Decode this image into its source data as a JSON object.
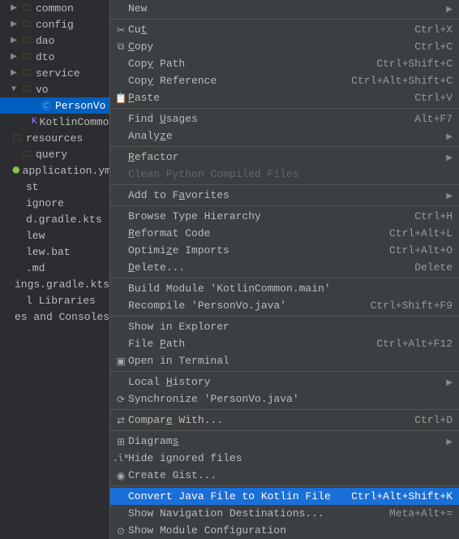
{
  "tree": {
    "items": [
      {
        "indent": 1,
        "arrow": "▶",
        "icon": "folder",
        "label": "common"
      },
      {
        "indent": 1,
        "arrow": "▶",
        "icon": "folder",
        "label": "config"
      },
      {
        "indent": 1,
        "arrow": "▶",
        "icon": "folder",
        "label": "dao"
      },
      {
        "indent": 1,
        "arrow": "▶",
        "icon": "folder",
        "label": "dto"
      },
      {
        "indent": 1,
        "arrow": "▶",
        "icon": "folder",
        "label": "service"
      },
      {
        "indent": 1,
        "arrow": "▼",
        "icon": "folderopen",
        "label": "vo"
      },
      {
        "indent": 3,
        "arrow": "",
        "icon": "kclass",
        "label": "PersonVo",
        "sel": true
      },
      {
        "indent": 3,
        "arrow": "",
        "icon": "kfile",
        "label": "KotlinCommonA"
      },
      {
        "indent": 0,
        "arrow": "",
        "icon": "folder",
        "label": "resources"
      },
      {
        "indent": 1,
        "arrow": "",
        "icon": "folder",
        "label": "query"
      },
      {
        "indent": 1,
        "arrow": "",
        "icon": "yml",
        "label": "application.yml"
      },
      {
        "indent": 0,
        "arrow": "",
        "icon": "",
        "label": "st"
      },
      {
        "indent": 0,
        "arrow": "",
        "icon": "",
        "label": "ignore"
      },
      {
        "indent": 0,
        "arrow": "",
        "icon": "",
        "label": "d.gradle.kts"
      },
      {
        "indent": 0,
        "arrow": "",
        "icon": "",
        "label": "lew"
      },
      {
        "indent": 0,
        "arrow": "",
        "icon": "",
        "label": "lew.bat"
      },
      {
        "indent": 0,
        "arrow": "",
        "icon": "",
        "label": ".md"
      },
      {
        "indent": 0,
        "arrow": "",
        "icon": "",
        "label": "ings.gradle.kts"
      },
      {
        "indent": 0,
        "arrow": "",
        "icon": "",
        "label": "l Libraries"
      },
      {
        "indent": 0,
        "arrow": "",
        "icon": "",
        "label": "es and Consoles"
      }
    ]
  },
  "menu": [
    {
      "icon": "",
      "label": "New",
      "shortcut": "",
      "sub": true
    },
    {
      "sep": true
    },
    {
      "icon": "✂",
      "label_html": "Cu<span class='u'>t</span>",
      "shortcut": "Ctrl+X"
    },
    {
      "icon": "⧉",
      "label_html": "<span class='u'>C</span>opy",
      "shortcut": "Ctrl+C"
    },
    {
      "icon": "",
      "label_html": "Cop<span class='u'>y</span> Path",
      "shortcut": "Ctrl+Shift+C"
    },
    {
      "icon": "",
      "label_html": "Cop<span class='u'>y</span> Reference",
      "shortcut": "Ctrl+Alt+Shift+C"
    },
    {
      "icon": "📋",
      "label_html": "<span class='u'>P</span>aste",
      "shortcut": "Ctrl+V"
    },
    {
      "sep": true
    },
    {
      "icon": "",
      "label_html": "Find <span class='u'>U</span>sages",
      "shortcut": "Alt+F7"
    },
    {
      "icon": "",
      "label_html": "Analy<span class='u'>z</span>e",
      "shortcut": "",
      "sub": true
    },
    {
      "sep": true
    },
    {
      "icon": "",
      "label_html": "<span class='u'>R</span>efactor",
      "shortcut": "",
      "sub": true
    },
    {
      "icon": "",
      "label": "Clean Python Compiled Files",
      "disabled": true
    },
    {
      "sep": true
    },
    {
      "icon": "",
      "label_html": "Add to F<span class='u'>a</span>vorites",
      "shortcut": "",
      "sub": true
    },
    {
      "sep": true
    },
    {
      "icon": "",
      "label": "Browse Type Hierarchy",
      "shortcut": "Ctrl+H"
    },
    {
      "icon": "",
      "label_html": "<span class='u'>R</span>eformat Code",
      "shortcut": "Ctrl+Alt+L"
    },
    {
      "icon": "",
      "label_html": "Optimi<span class='u'>z</span>e Imports",
      "shortcut": "Ctrl+Alt+O"
    },
    {
      "icon": "",
      "label_html": "<span class='u'>D</span>elete...",
      "shortcut": "Delete"
    },
    {
      "sep": true
    },
    {
      "icon": "",
      "label": "Build Module 'KotlinCommon.main'",
      "shortcut": ""
    },
    {
      "icon": "",
      "label": "Recompile 'PersonVo.java'",
      "shortcut": "Ctrl+Shift+F9"
    },
    {
      "sep": true
    },
    {
      "icon": "",
      "label": "Show in Explorer",
      "shortcut": ""
    },
    {
      "icon": "",
      "label_html": "File <span class='u'>P</span>ath",
      "shortcut": "Ctrl+Alt+F12"
    },
    {
      "icon": "▣",
      "label": "Open in Terminal",
      "shortcut": ""
    },
    {
      "sep": true
    },
    {
      "icon": "",
      "label_html": "Local <span class='u'>H</span>istory",
      "shortcut": "",
      "sub": true
    },
    {
      "icon": "⟳",
      "label": "Synchronize 'PersonVo.java'",
      "shortcut": ""
    },
    {
      "sep": true
    },
    {
      "icon": "⇄",
      "label_html": "Compar<span class='u'>e</span> With...",
      "shortcut": "Ctrl+D"
    },
    {
      "sep": true
    },
    {
      "icon": "⊞",
      "label_html": "Diagram<span class='u'>s</span>",
      "shortcut": "",
      "sub": true
    },
    {
      "icon": ".i*",
      "label": "Hide ignored files",
      "shortcut": ""
    },
    {
      "icon": "◉",
      "label": "Create Gist...",
      "shortcut": ""
    },
    {
      "sep": true
    },
    {
      "icon": "",
      "label": "Convert Java File to Kotlin File",
      "shortcut": "Ctrl+Alt+Shift+K",
      "highlight": true
    },
    {
      "icon": "",
      "label": "Show Navigation Destinations...",
      "shortcut": "Meta+Alt+="
    },
    {
      "icon": "⊙",
      "label": "Show Module Configuration",
      "shortcut": ""
    }
  ]
}
